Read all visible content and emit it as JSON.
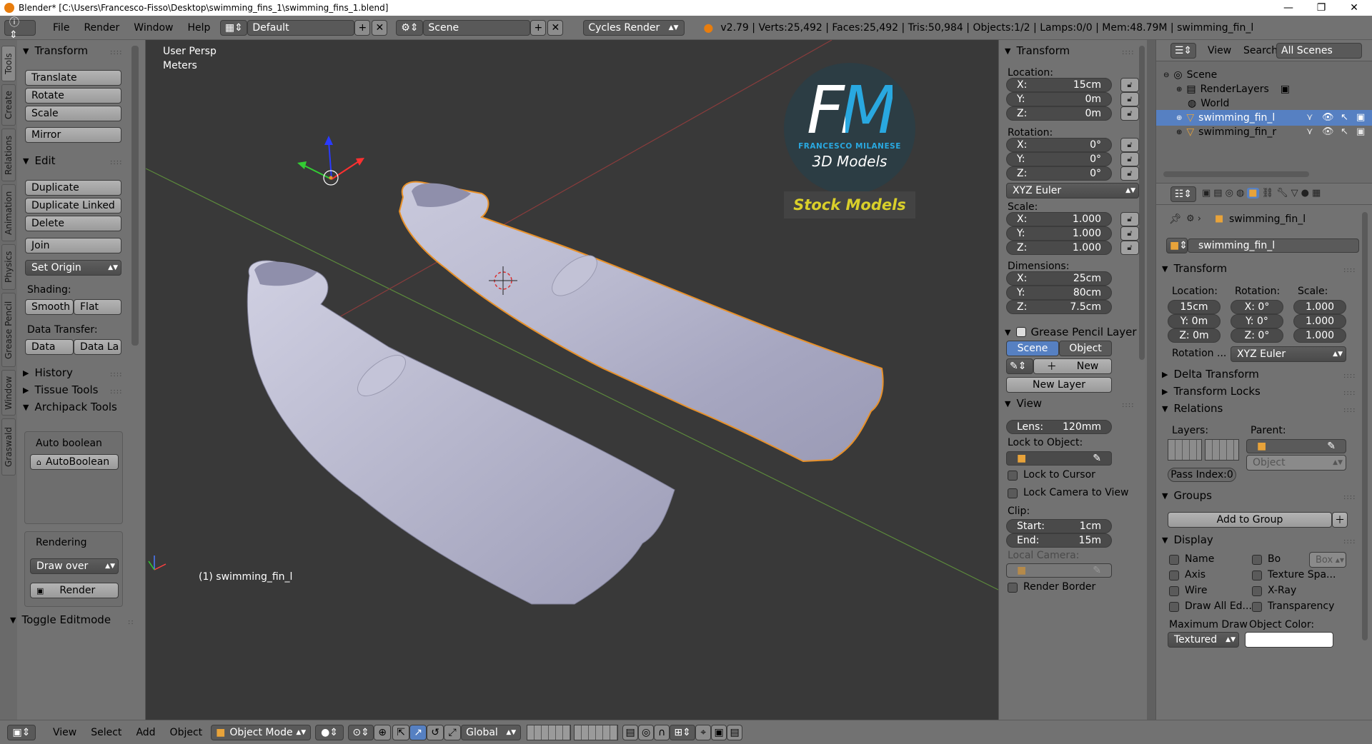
{
  "window": {
    "title": "Blender* [C:\\Users\\Francesco-Fisso\\Desktop\\swimming_fins_1\\swimming_fins_1.blend]",
    "minimize": "—",
    "maximize": "❐",
    "close": "✕"
  },
  "header": {
    "menus": [
      "File",
      "Render",
      "Window",
      "Help"
    ],
    "screen_layout": "Default",
    "scene": "Scene",
    "render_engine": "Cycles Render",
    "stats": "v2.79 | Verts:25,492 | Faces:25,492 | Tris:50,984 | Objects:1/2 | Lamps:0/0 | Mem:48.79M | swimming_fin_l"
  },
  "tool_tabs": [
    "Tools",
    "Create",
    "Relations",
    "Animation",
    "Physics",
    "Grease Pencil",
    "Window",
    "Graswald"
  ],
  "toolshelf": {
    "transform_title": "Transform",
    "translate": "Translate",
    "rotate": "Rotate",
    "scale": "Scale",
    "mirror": "Mirror",
    "edit_title": "Edit",
    "duplicate": "Duplicate",
    "duplicate_linked": "Duplicate Linked",
    "delete": "Delete",
    "join": "Join",
    "set_origin": "Set Origin",
    "shading_label": "Shading:",
    "smooth": "Smooth",
    "flat": "Flat",
    "data_transfer_label": "Data Transfer:",
    "data": "Data",
    "data_la": "Data La",
    "history": "History",
    "tissue_tools": "Tissue Tools",
    "archipack_tools": "Archipack Tools",
    "auto_boolean_label": "Auto boolean",
    "auto_boolean_btn": "AutoBoolean",
    "rendering_label": "Rendering",
    "draw_over": "Draw over",
    "render": "Render",
    "toggle_editmode": "Toggle Editmode"
  },
  "viewport": {
    "view_name": "User Persp",
    "units": "Meters",
    "object_label": "(1) swimming_fin_l",
    "logo_letters": "FM",
    "logo_name": "FRANCESCO MILANESE",
    "logo_sub": "3D Models",
    "stock_label": "Stock Models"
  },
  "bottom": {
    "menus": [
      "View",
      "Select",
      "Add",
      "Object"
    ],
    "mode": "Object Mode",
    "orientation": "Global"
  },
  "npanel": {
    "transform_title": "Transform",
    "location_label": "Location:",
    "loc": [
      {
        "axis": "X:",
        "value": "15cm"
      },
      {
        "axis": "Y:",
        "value": "0m"
      },
      {
        "axis": "Z:",
        "value": "0m"
      }
    ],
    "rotation_label": "Rotation:",
    "rot": [
      {
        "axis": "X:",
        "value": "0°"
      },
      {
        "axis": "Y:",
        "value": "0°"
      },
      {
        "axis": "Z:",
        "value": "0°"
      }
    ],
    "rotation_mode": "XYZ Euler",
    "scale_label": "Scale:",
    "scl": [
      {
        "axis": "X:",
        "value": "1.000"
      },
      {
        "axis": "Y:",
        "value": "1.000"
      },
      {
        "axis": "Z:",
        "value": "1.000"
      }
    ],
    "dimensions_label": "Dimensions:",
    "dim": [
      {
        "axis": "X:",
        "value": "25cm"
      },
      {
        "axis": "Y:",
        "value": "80cm"
      },
      {
        "axis": "Z:",
        "value": "7.5cm"
      }
    ],
    "grease_title": "Grease Pencil Layer",
    "scene_tab": "Scene",
    "object_tab": "Object",
    "new": "New",
    "new_layer": "New Layer",
    "view_title": "View",
    "lens_label": "Lens:",
    "lens_value": "120mm",
    "lock_to_object": "Lock to Object:",
    "lock_to_cursor": "Lock to Cursor",
    "lock_camera": "Lock Camera to View",
    "clip_label": "Clip:",
    "clip_start_label": "Start:",
    "clip_start": "1cm",
    "clip_end_label": "End:",
    "clip_end": "15m",
    "local_camera": "Local Camera:",
    "render_border": "Render Border"
  },
  "outliner": {
    "menus": [
      "View",
      "Search"
    ],
    "filter": "All Scenes",
    "items": [
      {
        "label": "Scene"
      },
      {
        "label": "RenderLayers"
      },
      {
        "label": "World"
      },
      {
        "label": "swimming_fin_l"
      },
      {
        "label": "swimming_fin_r"
      }
    ]
  },
  "properties": {
    "breadcrumb": "swimming_fin_l",
    "object_name": "swimming_fin_l",
    "transform_title": "Transform",
    "location_label": "Location:",
    "rotation_label": "Rotation:",
    "scale_label": "Scale:",
    "loc": [
      "15cm",
      "Y: 0m",
      "Z: 0m"
    ],
    "rot": [
      "X:  0°",
      "Y:  0°",
      "Z:  0°"
    ],
    "scl": [
      "1.000",
      "1.000",
      "1.000"
    ],
    "rotation_mode_label": "Rotation ...",
    "rotation_mode": "XYZ Euler",
    "delta_transform": "Delta Transform",
    "transform_locks": "Transform Locks",
    "relations_title": "Relations",
    "layers_label": "Layers:",
    "parent_label": "Parent:",
    "parent_type": "Object",
    "pass_index": "Pass Index:0",
    "groups_title": "Groups",
    "add_to_group": "Add to Group",
    "display_title": "Display",
    "name_cb": "Name",
    "bo_cb": "Bo",
    "box": "Box",
    "axis_cb": "Axis",
    "texture_space": "Texture Spa...",
    "wire_cb": "Wire",
    "xray_cb": "X-Ray",
    "draw_all_edges": "Draw All Ed...",
    "transparency_cb": "Transparency",
    "max_draw_label": "Maximum Draw",
    "object_color_label": "Object Color:",
    "max_draw_value": "Textured"
  },
  "colors": {
    "viewport_bg": "#393939",
    "panel_bg": "#727272",
    "selected_tab": "#5680c2",
    "orange_outline": "#e8912a",
    "logo_blue": "#29a8e0",
    "stock_yellow": "#d9cf2a"
  }
}
